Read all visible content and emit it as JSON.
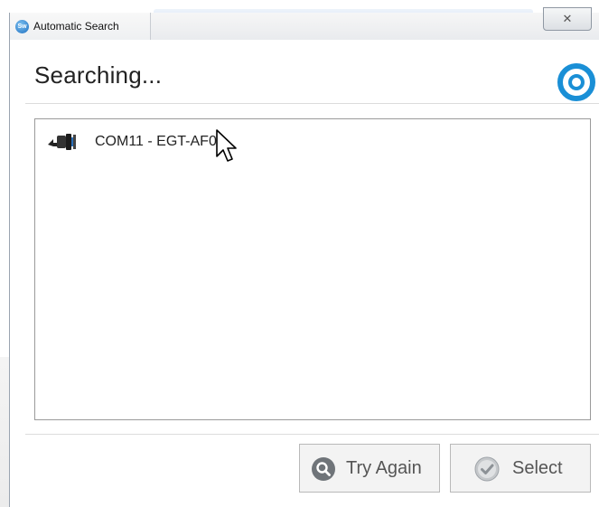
{
  "window": {
    "title": "Automatic Search",
    "app_icon_text": "Sw",
    "close_glyph": "✕"
  },
  "header": {
    "heading": "Searching..."
  },
  "results": {
    "items": [
      {
        "label": "COM11 - EGT-AF01",
        "icon": "serial-port-icon"
      }
    ]
  },
  "buttons": {
    "try_again": "Try Again",
    "select": "Select"
  },
  "colors": {
    "logo_blue": "#1a8fd6",
    "accent_dark": "#1f4f8d"
  }
}
